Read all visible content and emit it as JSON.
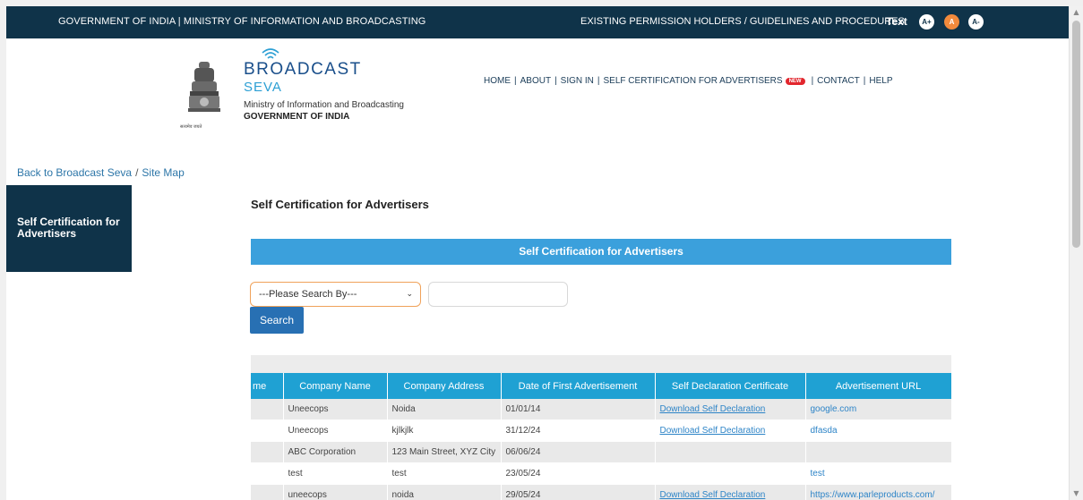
{
  "topbar": {
    "gov_text": "GOVERNMENT OF INDIA | MINISTRY OF INFORMATION AND BROADCASTING",
    "right_text": "EXISTING PERMISSION HOLDERS / GUIDELINES AND PROCEDURES",
    "text_label": "Text",
    "font_plus": "A+",
    "font_normal": "A",
    "font_minus": "A-"
  },
  "brand": {
    "line1": "BROADCAST",
    "line2": "SEVA",
    "sub1": "Ministry of Information and Broadcasting",
    "sub2": "GOVERNMENT OF INDIA",
    "emblem_caption": "सत्यमेव जयते"
  },
  "nav": {
    "home": "HOME",
    "about": "ABOUT",
    "signin": "SIGN IN",
    "self_cert": "SELF CERTIFICATION FOR ADVERTISERS",
    "new_badge": "NEW",
    "contact": "CONTACT",
    "help": "HELP",
    "sep": "|"
  },
  "breadcrumb": {
    "back": "Back to Broadcast Seva",
    "sep": "/",
    "sitemap": "Site Map"
  },
  "sidebar": {
    "item": "Self Certification for Advertisers"
  },
  "main": {
    "title": "Self Certification for Advertisers",
    "panel_header": "Self Certification for Advertisers",
    "select_value": "---Please Search By---",
    "search_input_value": "",
    "search_button": "Search"
  },
  "table": {
    "headers": [
      "me",
      "Company Name",
      "Company Address",
      "Date of First Advertisement",
      "Self Declaration Certificate",
      "Advertisement URL"
    ],
    "rows": [
      [
        "",
        "Uneecops",
        "Noida",
        "01/01/14",
        "Download Self Declaration",
        "google.com"
      ],
      [
        "",
        "Uneecops",
        "kjlkjlk",
        "31/12/24",
        "Download Self Declaration",
        "dfasda"
      ],
      [
        "",
        "ABC Corporation",
        "123 Main Street, XYZ City",
        "06/06/24",
        "",
        ""
      ],
      [
        "",
        "test",
        "test",
        "23/05/24",
        "",
        "test"
      ],
      [
        "",
        "uneecops",
        "noida",
        "29/05/24",
        "Download Self Declaration",
        "https://www.parleproducts.com/"
      ]
    ]
  },
  "colors": {
    "topbar_bg": "#0f3349",
    "panel_header": "#3ba0dc",
    "table_header": "#1fa1d3",
    "accent_orange": "#f28a3c",
    "search_button": "#2870b3"
  }
}
